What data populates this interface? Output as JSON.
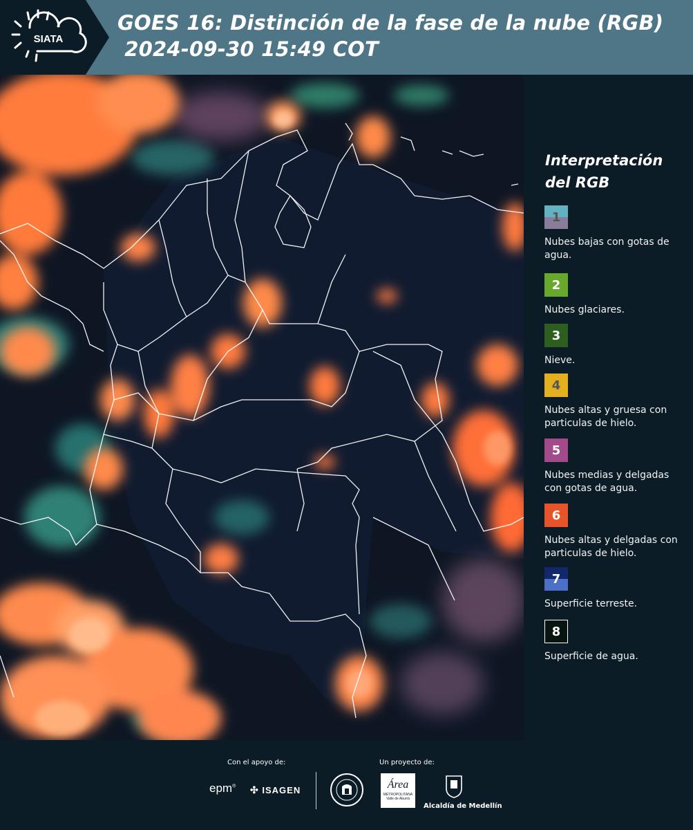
{
  "header": {
    "logo_text": "SIATA",
    "title": "GOES 16: Distinción de la fase de la nube (RGB)\n 2024-09-30 15:49 COT"
  },
  "map": {
    "icon": "satellite-rgb-map",
    "land_color": "#101a2c",
    "ocean_color": "#071018",
    "cloud_colors": [
      "#ff7a3c",
      "#ff9a60",
      "#3ba59a",
      "#c37a9a"
    ]
  },
  "legend": {
    "title": "Interpretación\ndel RGB",
    "items": [
      {
        "num": "1",
        "label": "Nubes bajas con gotas de agua.",
        "color_top": "#62b2c2",
        "color_bottom": "#8a7d9c",
        "num_color": "#555"
      },
      {
        "num": "2",
        "label": "Nubes glaciares.",
        "color_top": "#67a82d",
        "color_bottom": "#67a82d",
        "num_color": "#fff"
      },
      {
        "num": "3",
        "label": "Nieve.",
        "color_top": "#2e5e1f",
        "color_bottom": "#2e5e1f",
        "num_color": "#fff"
      },
      {
        "num": "4",
        "label": "Nubes altas y gruesa con particulas de hielo.",
        "color_top": "#e3b120",
        "color_bottom": "#e3b120",
        "num_color": "#555"
      },
      {
        "num": "5",
        "label": "Nubes medias y delgadas con gotas de agua.",
        "color_top": "#a34a8a",
        "color_bottom": "#a34a8a",
        "num_color": "#fff"
      },
      {
        "num": "6",
        "label": "Nubes altas y delgadas con particulas de hielo.",
        "color_top": "#e8542a",
        "color_bottom": "#e8542a",
        "num_color": "#fff"
      },
      {
        "num": "7",
        "label": "Superficie terreste.",
        "color_top": "#12286a",
        "color_bottom": "#4c6fc7",
        "num_color": "#fff"
      },
      {
        "num": "8",
        "label": "Superficie de agua.",
        "color_top": "#07140f",
        "color_bottom": "#07140f",
        "num_color": "#fff"
      }
    ]
  },
  "footer": {
    "support_label": "Con el apoyo de:",
    "project_label": "Un proyecto de:",
    "partners": [
      "epm",
      "ISAGEN"
    ],
    "area_logo": {
      "word": "Área",
      "line1": "METROPOLITANA",
      "line2": "Valle de Aburrá"
    },
    "alcaldia_label": "Alcaldía de Medellín"
  }
}
